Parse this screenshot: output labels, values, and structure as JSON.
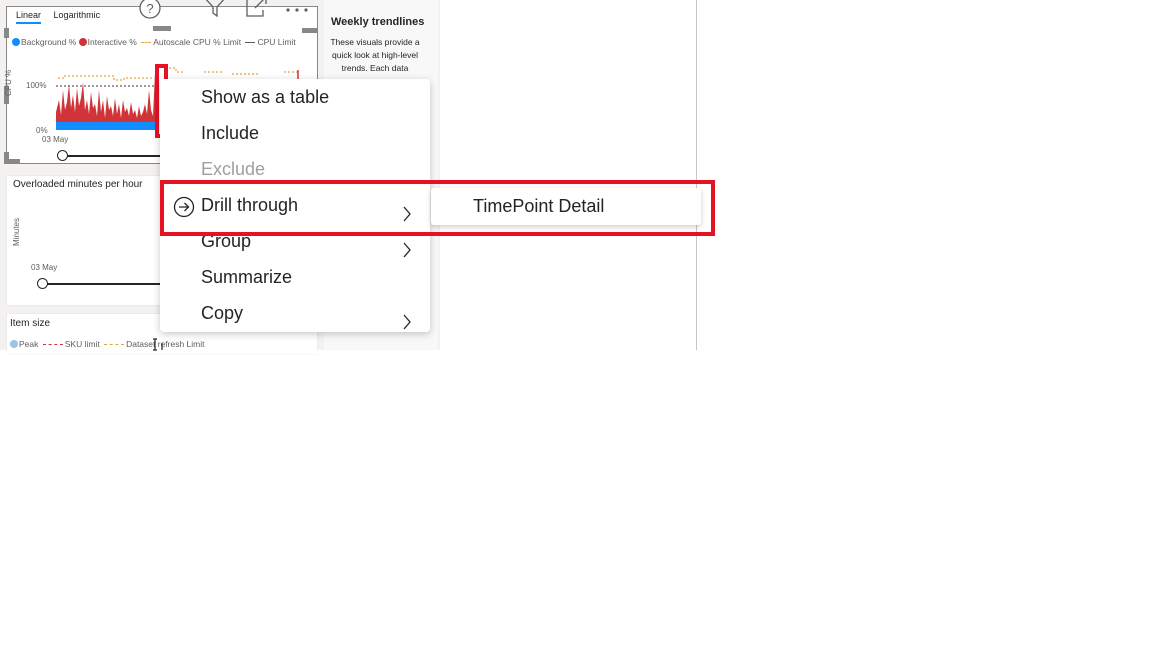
{
  "visual1": {
    "tabs": [
      "Linear",
      "Logarithmic"
    ],
    "legend": [
      {
        "label": "Background %",
        "color": "#118dff",
        "marker": "dot"
      },
      {
        "label": "Interactive %",
        "color": "#d13438",
        "marker": "dot"
      },
      {
        "label": "Autoscale CPU % Limit",
        "color": "#e8a33d",
        "marker": "dash"
      },
      {
        "label": "CPU Limit",
        "color": "#605e5c",
        "marker": "dash"
      }
    ],
    "y_axis_label": "CPU %",
    "y_ticks": [
      "100%",
      "0%"
    ],
    "x_label": "03 May",
    "header_icons": [
      "help-icon",
      "filter-icon",
      "focus-mode-icon",
      "more-options-icon"
    ]
  },
  "visual2": {
    "title": "Overloaded minutes per hour",
    "y_axis_label": "Minutes",
    "x_label": "03 May"
  },
  "visual3": {
    "title": "Item size",
    "legend": [
      {
        "label": "Peak",
        "color": "#9dc3e6",
        "marker": "dot"
      },
      {
        "label": "SKU limit",
        "color": "#d13438",
        "marker": "dash"
      },
      {
        "label": "Dataset refresh Limit",
        "color": "#e8a33d",
        "marker": "dash"
      }
    ]
  },
  "trend": {
    "title": "Weekly trendlines",
    "text": "These visuals provide a quick look at high-level trends. Each data"
  },
  "context_menu": {
    "items": [
      {
        "label": "Show as a table",
        "disabled": false,
        "submenu": false
      },
      {
        "label": "Include",
        "disabled": false,
        "submenu": false
      },
      {
        "label": "Exclude",
        "disabled": true,
        "submenu": false
      },
      {
        "label": "Drill through",
        "disabled": false,
        "submenu": true,
        "icon": "drill-through-icon"
      },
      {
        "label": "Group",
        "disabled": false,
        "submenu": true
      },
      {
        "label": "Summarize",
        "disabled": false,
        "submenu": false
      },
      {
        "label": "Copy",
        "disabled": false,
        "submenu": true
      }
    ],
    "submenu": {
      "items": [
        "TimePoint Detail"
      ]
    }
  },
  "colors": {
    "highlight": "#e81123",
    "background_series": "#118dff",
    "interactive_series": "#d13438",
    "autoscale_limit": "#e8a33d"
  }
}
